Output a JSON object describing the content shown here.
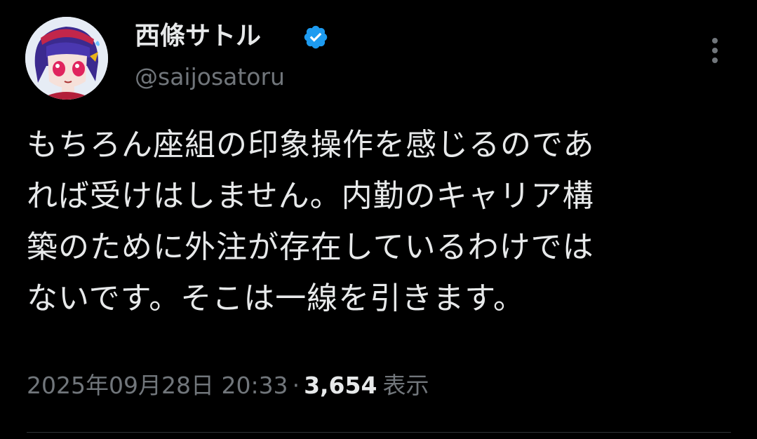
{
  "author": {
    "display_name": "西條サトル",
    "handle": "@saijosatoru",
    "verified": true,
    "verified_icon": "verified-badge-icon",
    "avatar_icon": "anime-character-avatar"
  },
  "tweet": {
    "text_lines": [
      "もちろん座組の印象操作を感じるのであ",
      "れば受けはしません。内勤のキャリア構",
      "築のために外注が存在しているわけでは",
      "ないです。そこは一線を引きます。"
    ]
  },
  "meta": {
    "timestamp": "2025年09月28日 20:33",
    "separator": "·",
    "views_count": "3,654",
    "views_label": "表示"
  },
  "more_icon": "more-vertical-icon",
  "colors": {
    "background": "#000000",
    "primary_text": "#e7e9ea",
    "secondary_text": "#71767b",
    "verified_blue": "#1d9bf0"
  }
}
